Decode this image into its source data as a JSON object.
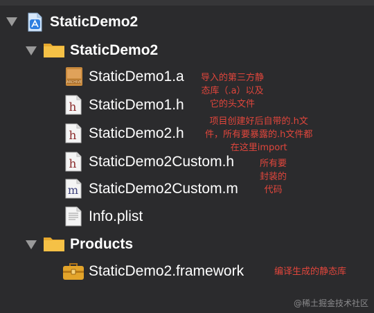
{
  "tree": {
    "project": {
      "label": "StaticDemo2",
      "icon": "xcode-project-icon"
    },
    "group_main": {
      "label": "StaticDemo2",
      "icon": "folder-icon"
    },
    "files": [
      {
        "label": "StaticDemo1.a",
        "icon": "static-library-icon"
      },
      {
        "label": "StaticDemo1.h",
        "icon": "header-file-icon"
      },
      {
        "label": "StaticDemo2.h",
        "icon": "header-file-icon"
      },
      {
        "label": "StaticDemo2Custom.h",
        "icon": "header-file-icon"
      },
      {
        "label": "StaticDemo2Custom.m",
        "icon": "objc-source-file-icon"
      },
      {
        "label": "Info.plist",
        "icon": "plist-file-icon"
      }
    ],
    "group_products": {
      "label": "Products",
      "icon": "folder-icon"
    },
    "product": {
      "label": "StaticDemo2.framework",
      "icon": "framework-toolbox-icon"
    }
  },
  "annotations": {
    "note1": [
      "导入的第三方静",
      "态库（.a）以及",
      "它的头文件"
    ],
    "note2": [
      "项目创建好后自带的.h文",
      "件，所有要暴露的.h文件都",
      "在这里import"
    ],
    "note3": [
      "所有要",
      "封装的",
      "代码"
    ],
    "note4": "编译生成的静态库"
  },
  "watermark": "@稀土掘金技术社区",
  "colors": {
    "background": "#2b2b2d",
    "annotation": "#e0463c",
    "folder": "#f5c146",
    "disclosure": "#9a9a9a"
  }
}
